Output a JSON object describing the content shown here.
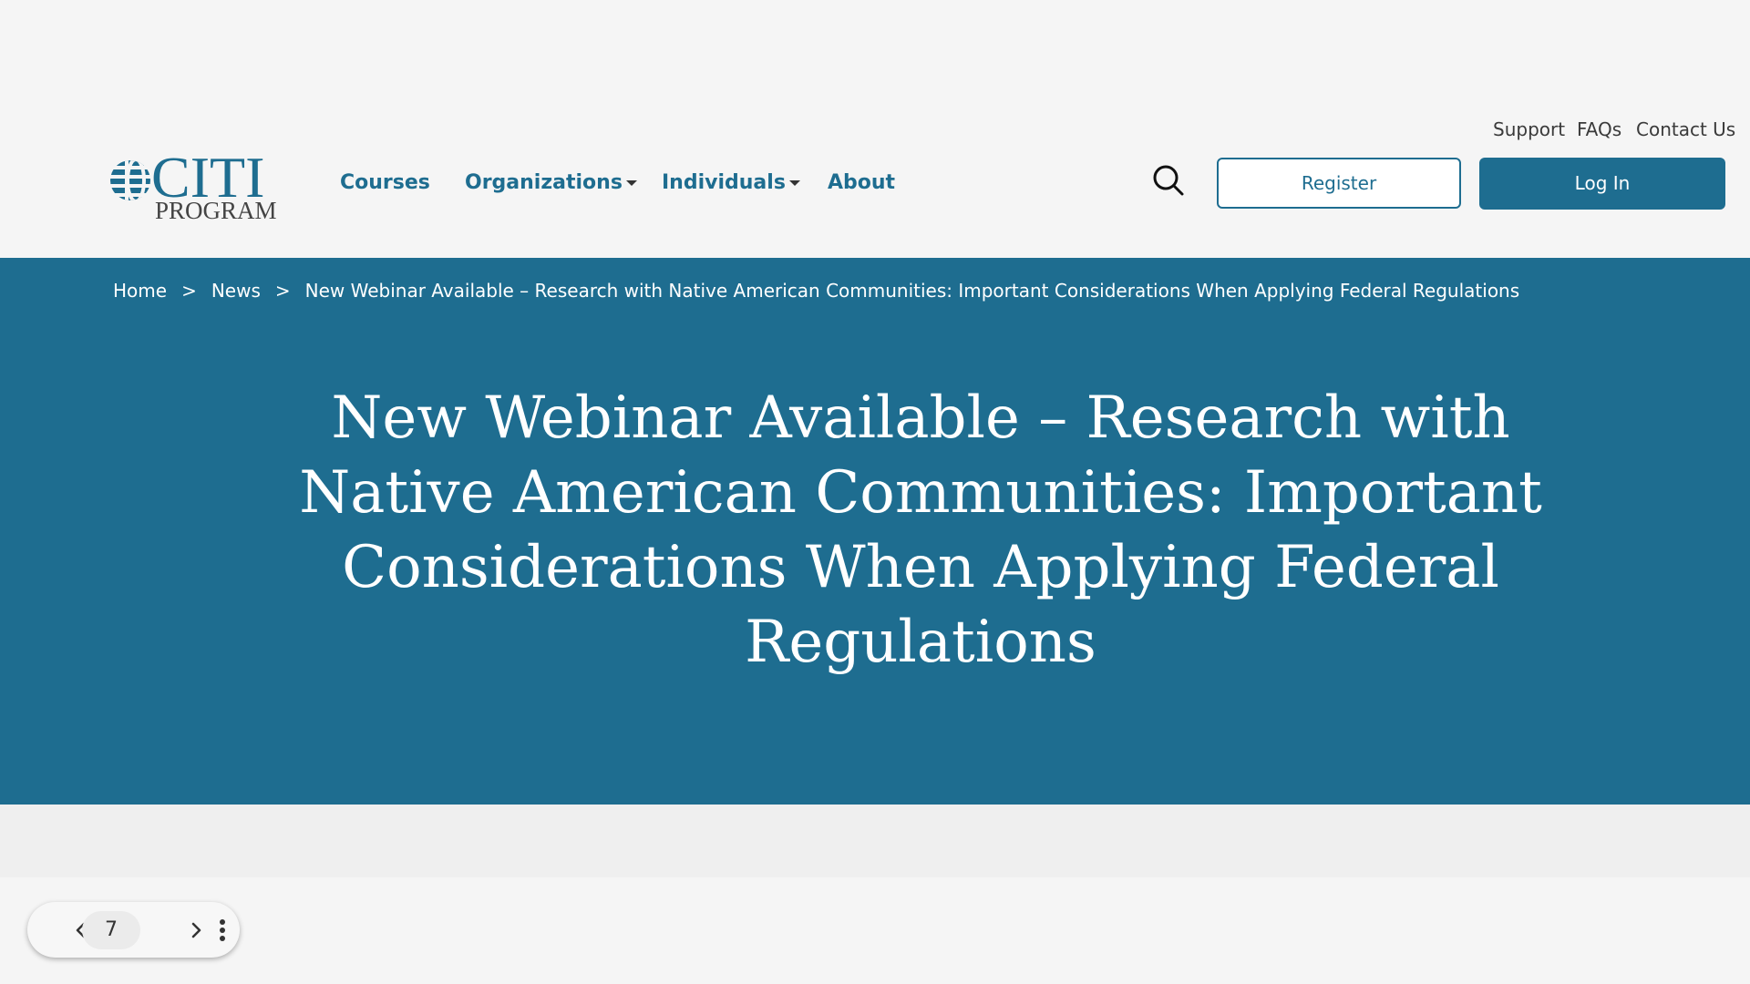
{
  "header": {
    "logo": {
      "name": "CITI",
      "subtitle": "PROGRAM"
    },
    "nav": [
      {
        "label": "Courses",
        "has_dropdown": false
      },
      {
        "label": "Organizations",
        "has_dropdown": true
      },
      {
        "label": "Individuals",
        "has_dropdown": true
      },
      {
        "label": "About",
        "has_dropdown": false
      }
    ],
    "utility_links": [
      "Support",
      "FAQs",
      "Contact Us"
    ],
    "search_icon": "search-icon",
    "register_label": "Register",
    "login_label": "Log In"
  },
  "hero": {
    "breadcrumb": [
      "Home",
      "News",
      "New Webinar Available – Research with Native American Communities: Important Considerations When Applying Federal Regulations"
    ],
    "breadcrumb_separator": ">",
    "title": "New Webinar Available – Research with Native American Communities: Important Considerations When Applying Federal Regulations"
  },
  "pager": {
    "current_page": "7",
    "prev_icon": "chevron-left-icon",
    "next_icon": "chevron-right-icon",
    "more_icon": "more-vertical-icon"
  },
  "colors": {
    "brand": "#1e6d90",
    "page_background": "#f5f5f5",
    "text_dark": "#3a3a3a",
    "white": "#ffffff"
  }
}
